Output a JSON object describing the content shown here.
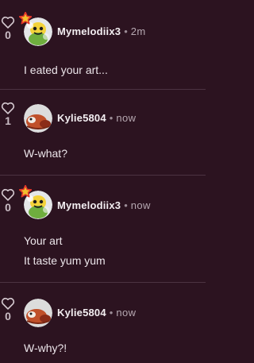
{
  "comments": [
    {
      "likes": "0",
      "username": "Mymelodiix3",
      "time": "2m",
      "lines": [
        "I eated your art..."
      ],
      "avatar": "melody-avatar",
      "has_badge": true
    },
    {
      "likes": "1",
      "username": "Kylie5804",
      "time": "now",
      "lines": [
        "W-what?"
      ],
      "avatar": "red-panda-avatar",
      "has_badge": false
    },
    {
      "likes": "0",
      "username": "Mymelodiix3",
      "time": "now",
      "lines": [
        "Your art",
        "It taste yum yum"
      ],
      "avatar": "melody-avatar",
      "has_badge": true
    },
    {
      "likes": "0",
      "username": "Kylie5804",
      "time": "now",
      "lines": [
        "W-why?!"
      ],
      "avatar": "red-panda-avatar",
      "has_badge": false
    }
  ],
  "separator": "•",
  "colors": {
    "background": "#2c1320",
    "divider": "#4c3342",
    "text": "#ece5ea",
    "muted": "#b6a8b1",
    "badge": "#e2352a"
  }
}
